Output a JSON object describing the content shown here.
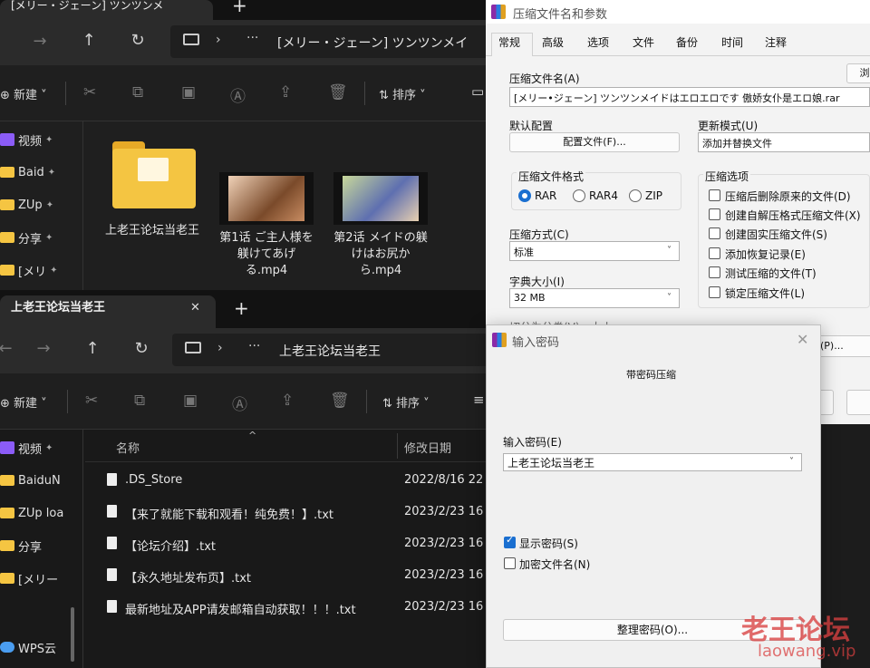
{
  "top_window": {
    "tab_title": "[メリー・ジェーン] ツンツンメ",
    "address_path": "[メリー・ジェーン] ツンツンメイ",
    "toolbar": {
      "new_label": "新建",
      "sort_label": "排序"
    },
    "sidebar": [
      {
        "label": "视频",
        "icon": "video-icon"
      },
      {
        "label": "Baid",
        "icon": "folder-icon"
      },
      {
        "label": "ZUp",
        "icon": "folder-icon"
      },
      {
        "label": "分享",
        "icon": "folder-icon"
      },
      {
        "label": "[メリ",
        "icon": "folder-icon"
      }
    ],
    "items": [
      {
        "name": "上老王论坛当老王"
      },
      {
        "name": "第1话 ご主人様を躾けてあげる.mp4"
      },
      {
        "name": "第2话 メイドの躾けはお尻から.mp4"
      }
    ]
  },
  "bottom_window": {
    "tab_title": "上老王论坛当老王",
    "address_path": "上老王论坛当老王",
    "toolbar": {
      "new_label": "新建",
      "sort_label": "排序"
    },
    "sidebar": [
      {
        "label": "视频",
        "icon": "video-icon"
      },
      {
        "label": "BaiduN",
        "icon": "folder-icon"
      },
      {
        "label": "ZUp loa",
        "icon": "folder-icon"
      },
      {
        "label": "分享",
        "icon": "folder-icon"
      },
      {
        "label": "[メリー",
        "icon": "folder-icon"
      },
      {
        "label": "WPS云",
        "icon": "cloud-icon"
      }
    ],
    "columns": {
      "name": "名称",
      "modified": "修改日期"
    },
    "files": [
      {
        "name": ".DS_Store",
        "date": "2022/8/16 22"
      },
      {
        "name": "【来了就能下载和观看！纯免费！】.txt",
        "date": "2023/2/23 16"
      },
      {
        "name": "【论坛介绍】.txt",
        "date": "2023/2/23 16"
      },
      {
        "name": "【永久地址发布页】.txt",
        "date": "2023/2/23 16"
      },
      {
        "name": "最新地址及APP请发邮箱自动获取！！！.txt",
        "date": "2023/2/23 16"
      }
    ]
  },
  "archive_dialog": {
    "title": "压缩文件名和参数",
    "tabs": [
      "常规",
      "高级",
      "选项",
      "文件",
      "备份",
      "时间",
      "注释"
    ],
    "archive_name_label": "压缩文件名(A)",
    "browse_label": "浏",
    "archive_name_value": "[メリー•ジェーン] ツンツンメイドはエロエロです 傲娇女仆是エロ娘.rar",
    "default_profile_label": "默认配置",
    "profile_button": "配置文件(F)...",
    "update_mode_label": "更新模式(U)",
    "update_mode_value": "添加并替换文件",
    "format_group_label": "压缩文件格式",
    "formats": [
      "RAR",
      "RAR4",
      "ZIP"
    ],
    "selected_format": "RAR",
    "method_label": "压缩方式(C)",
    "method_value": "标准",
    "dict_label": "字典大小(I)",
    "dict_value": "32 MB",
    "split_label": "切分为分卷(V)，大小",
    "options_group_label": "压缩选项",
    "options": [
      {
        "label": "压缩后删除原来的文件(D)",
        "checked": false
      },
      {
        "label": "创建自解压格式压缩文件(X)",
        "checked": false
      },
      {
        "label": "创建固实压缩文件(S)",
        "checked": false
      },
      {
        "label": "添加恢复记录(E)",
        "checked": false
      },
      {
        "label": "测试压缩的文件(T)",
        "checked": false
      },
      {
        "label": "锁定压缩文件(L)",
        "checked": false
      }
    ],
    "set_password_button": "(P)..."
  },
  "password_dialog": {
    "title": "输入密码",
    "subtitle": "带密码压缩",
    "password_label": "输入密码(E)",
    "password_value": "上老王论坛当老王",
    "show_password_label": "显示密码(S)",
    "show_password_checked": true,
    "encrypt_names_label": "加密文件名(N)",
    "encrypt_names_checked": false,
    "organize_button": "整理密码(O)..."
  },
  "watermark": {
    "title": "老王论坛",
    "url": "laowang.vip"
  },
  "colors": {
    "dark_bg": "#1f1f1f",
    "accent": "#1a6fd0",
    "watermark": "#d94040"
  }
}
